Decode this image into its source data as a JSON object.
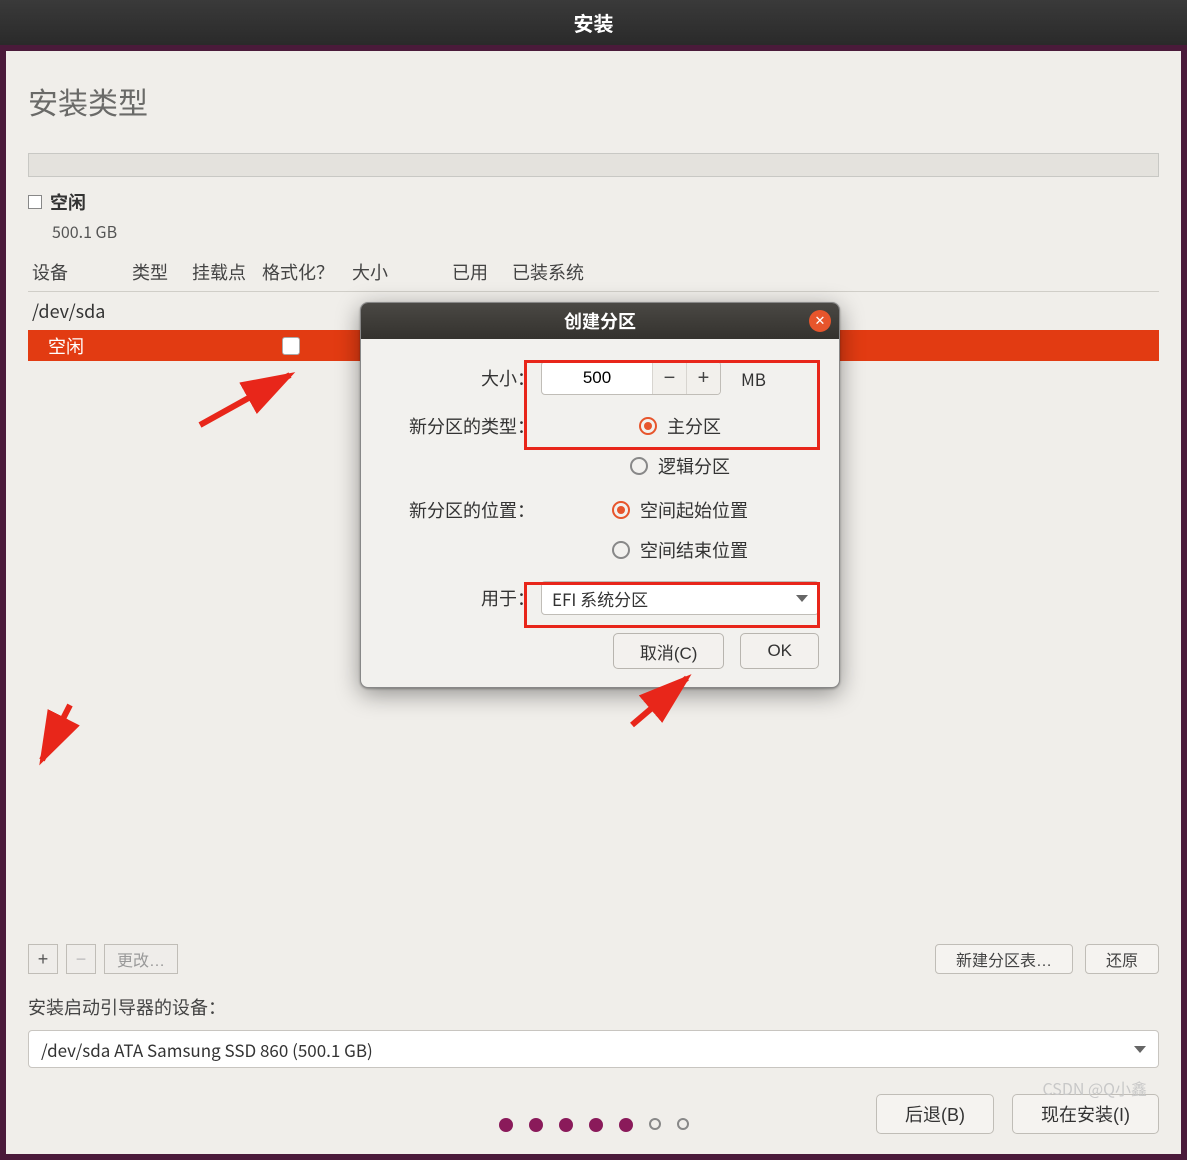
{
  "window": {
    "title": "安装"
  },
  "page": {
    "title": "安装类型"
  },
  "legend": {
    "label": "空闲",
    "size": "500.1 GB"
  },
  "columns": {
    "device": "设备",
    "type": "类型",
    "mount": "挂载点",
    "format": "格式化？",
    "size": "大小",
    "used": "已用",
    "system": "已装系统"
  },
  "rows": {
    "sda": "/dev/sda",
    "free": "空闲"
  },
  "toolbar": {
    "add": "+",
    "remove": "−",
    "change": "更改…",
    "new_table": "新建分区表…",
    "revert": "还原"
  },
  "boot": {
    "label": "安装启动引导器的设备：",
    "value": "/dev/sda   ATA Samsung SSD 860 (500.1 GB)"
  },
  "footer": {
    "back": "后退(B)",
    "install": "现在安装(I)"
  },
  "modal": {
    "title": "创建分区",
    "size_label": "大小：",
    "size_value": "500",
    "unit": "MB",
    "type_label": "新分区的类型：",
    "type_primary": "主分区",
    "type_logical": "逻辑分区",
    "loc_label": "新分区的位置：",
    "loc_begin": "空间起始位置",
    "loc_end": "空间结束位置",
    "use_label": "用于：",
    "use_value": "EFI 系统分区",
    "cancel": "取消(C)",
    "ok": "OK"
  },
  "watermark": "CSDN @Q小鑫"
}
